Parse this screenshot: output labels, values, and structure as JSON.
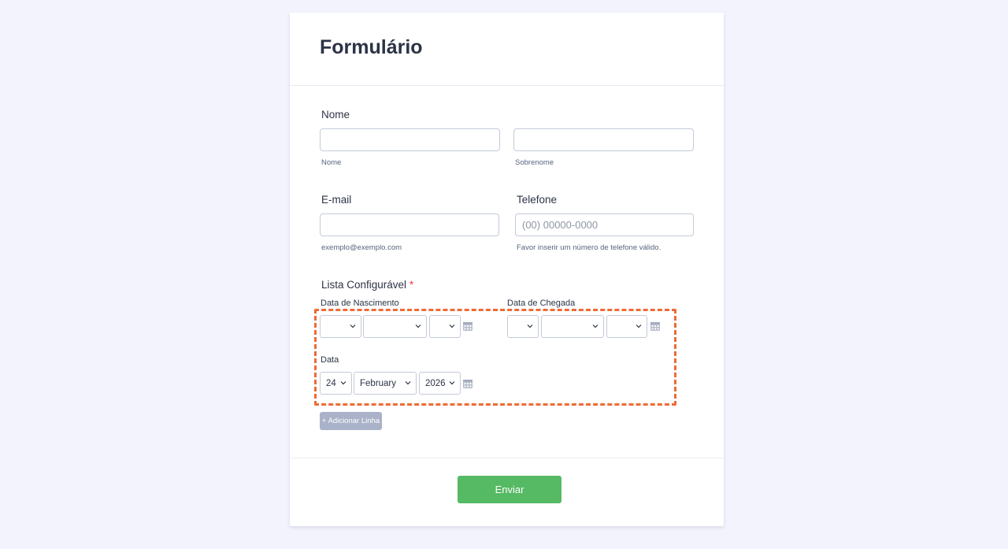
{
  "form": {
    "title": "Formulário",
    "name": {
      "label": "Nome",
      "first_sublabel": "Nome",
      "last_sublabel": "Sobrenome",
      "first_value": "",
      "last_value": ""
    },
    "email": {
      "label": "E-mail",
      "sublabel": "exemplo@exemplo.com",
      "value": ""
    },
    "phone": {
      "label": "Telefone",
      "placeholder": "(00) 00000-0000",
      "sublabel": "Favor inserir um número de telefone válido."
    },
    "config_list": {
      "label": "Lista Configurável",
      "required_mark": "*",
      "birth_date": {
        "label": "Data de Nascimento",
        "day": "",
        "month": "",
        "year": ""
      },
      "arrival_date": {
        "label": "Data de Chegada",
        "day": "",
        "month": "",
        "year": ""
      },
      "date": {
        "label": "Data",
        "day": "24",
        "month": "February",
        "year": "2026"
      },
      "add_row_label": "+ Adicionar Linha"
    },
    "submit_label": "Enviar"
  },
  "colors": {
    "background": "#f2f3fd",
    "highlight_dash": "#ee6a35",
    "submit": "#56b963",
    "add_button": "#a9b2c8",
    "required": "#f23a3c"
  },
  "icons": [
    "chevron-down-icon",
    "calendar-icon"
  ]
}
